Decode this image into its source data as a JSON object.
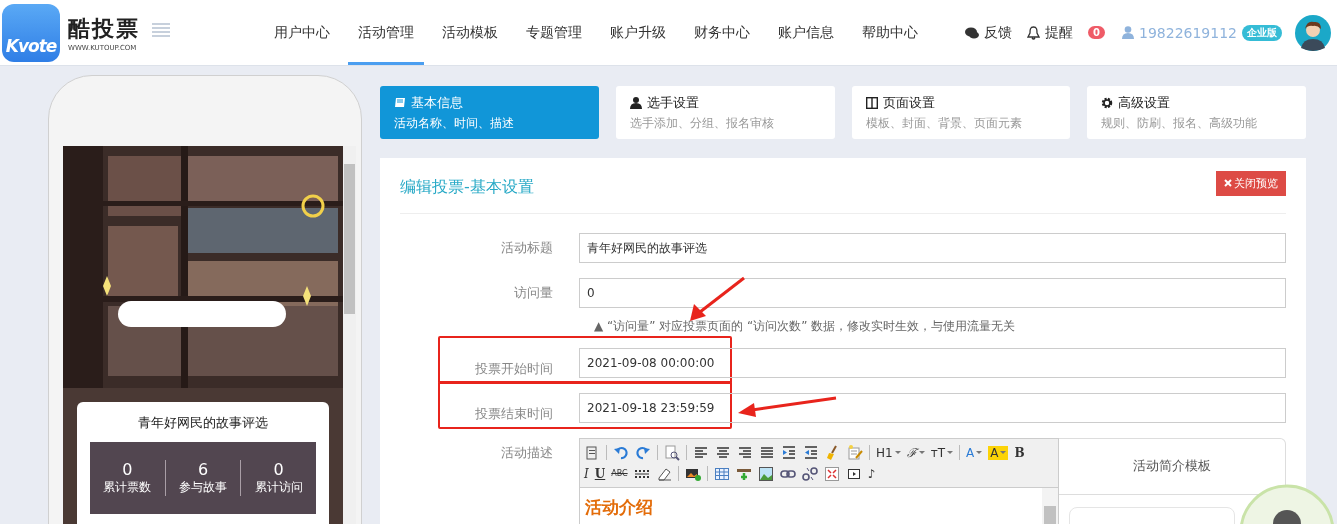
{
  "header": {
    "logo_mark": "Kvote",
    "logo_text": "酷投票",
    "logo_url": "WWW.KUTOUP.COM",
    "nav": [
      {
        "label": "用户中心",
        "selected": false
      },
      {
        "label": "活动管理",
        "selected": true
      },
      {
        "label": "活动模板",
        "selected": false
      },
      {
        "label": "专题管理",
        "selected": false
      },
      {
        "label": "账户升级",
        "selected": false
      },
      {
        "label": "财务中心",
        "selected": false
      },
      {
        "label": "账户信息",
        "selected": false
      },
      {
        "label": "帮助中心",
        "selected": false
      }
    ],
    "feedback": "反馈",
    "reminder": "提醒",
    "reminder_count": "0",
    "phone": "19822619112",
    "plan_badge": "企业版"
  },
  "preview": {
    "title": "青年好网民的故事评选",
    "stats": [
      {
        "value": "0",
        "label": "累计票数"
      },
      {
        "value": "6",
        "label": "参与故事"
      },
      {
        "value": "0",
        "label": "累计访问"
      }
    ]
  },
  "steps": [
    {
      "title": "基本信息",
      "subtitle": "活动名称、时间、描述",
      "selected": true
    },
    {
      "title": "选手设置",
      "subtitle": "选手添加、分组、报名审核",
      "selected": false
    },
    {
      "title": "页面设置",
      "subtitle": "模板、封面、背景、页面元素",
      "selected": false
    },
    {
      "title": "高级设置",
      "subtitle": "规则、防刷、报名、高级功能",
      "selected": false
    }
  ],
  "panel": {
    "title": "编辑投票-基本设置",
    "close_button": "关闭预览",
    "fields": [
      {
        "label": "活动标题",
        "value": "青年好网民的故事评选",
        "highlighted": false
      },
      {
        "label": "访问量",
        "value": "0",
        "highlighted": false,
        "hint": "▲ “访问量” 对应投票页面的 “访问次数” 数据，修改实时生效，与使用流量无关"
      },
      {
        "label": "投票开始时间",
        "value": "2021-09-08 00:00:00",
        "highlighted": true
      },
      {
        "label": "投票结束时间",
        "value": "2021-09-18 23:59:59",
        "highlighted": true
      }
    ],
    "description_label": "活动描述",
    "toolbar": [
      [
        {
          "kind": "icon"
        },
        {
          "kind": "divider"
        },
        {
          "kind": "icon"
        },
        {
          "kind": "icon"
        },
        {
          "kind": "divider"
        },
        {
          "kind": "icon"
        },
        {
          "kind": "divider"
        },
        {
          "kind": "icon"
        },
        {
          "kind": "icon"
        },
        {
          "kind": "icon"
        },
        {
          "kind": "icon"
        },
        {
          "kind": "icon"
        },
        {
          "kind": "icon"
        },
        {
          "kind": "icon"
        },
        {
          "kind": "icon"
        },
        {
          "kind": "divider"
        },
        {
          "kind": "text",
          "label": "H1",
          "dropdown": true
        },
        {
          "kind": "italic",
          "label": "ℱ",
          "dropdown": true
        },
        {
          "kind": "text",
          "label": "тT",
          "dropdown": true
        },
        {
          "kind": "divider"
        },
        {
          "kind": "color-text",
          "label": "A",
          "dropdown": true
        },
        {
          "kind": "highlight-text",
          "label": "A",
          "dropdown": true
        },
        {
          "kind": "bold",
          "label": "B",
          "dropdown": false
        }
      ],
      [
        {
          "kind": "italic",
          "label": "I",
          "dropdown": false
        },
        {
          "kind": "underline",
          "label": "U",
          "dropdown": false
        },
        {
          "kind": "strike",
          "label": "ABC",
          "dropdown": false
        },
        {
          "kind": "icon"
        },
        {
          "kind": "icon"
        },
        {
          "kind": "divider"
        },
        {
          "kind": "icon"
        },
        {
          "kind": "divider"
        },
        {
          "kind": "icon"
        },
        {
          "kind": "icon"
        },
        {
          "kind": "icon"
        },
        {
          "kind": "icon"
        },
        {
          "kind": "icon"
        },
        {
          "kind": "icon"
        },
        {
          "kind": "icon"
        },
        {
          "kind": "text",
          "label": "♪",
          "dropdown": false
        }
      ]
    ],
    "editor_heading": "活动介绍",
    "template_title": "活动简介模板"
  }
}
